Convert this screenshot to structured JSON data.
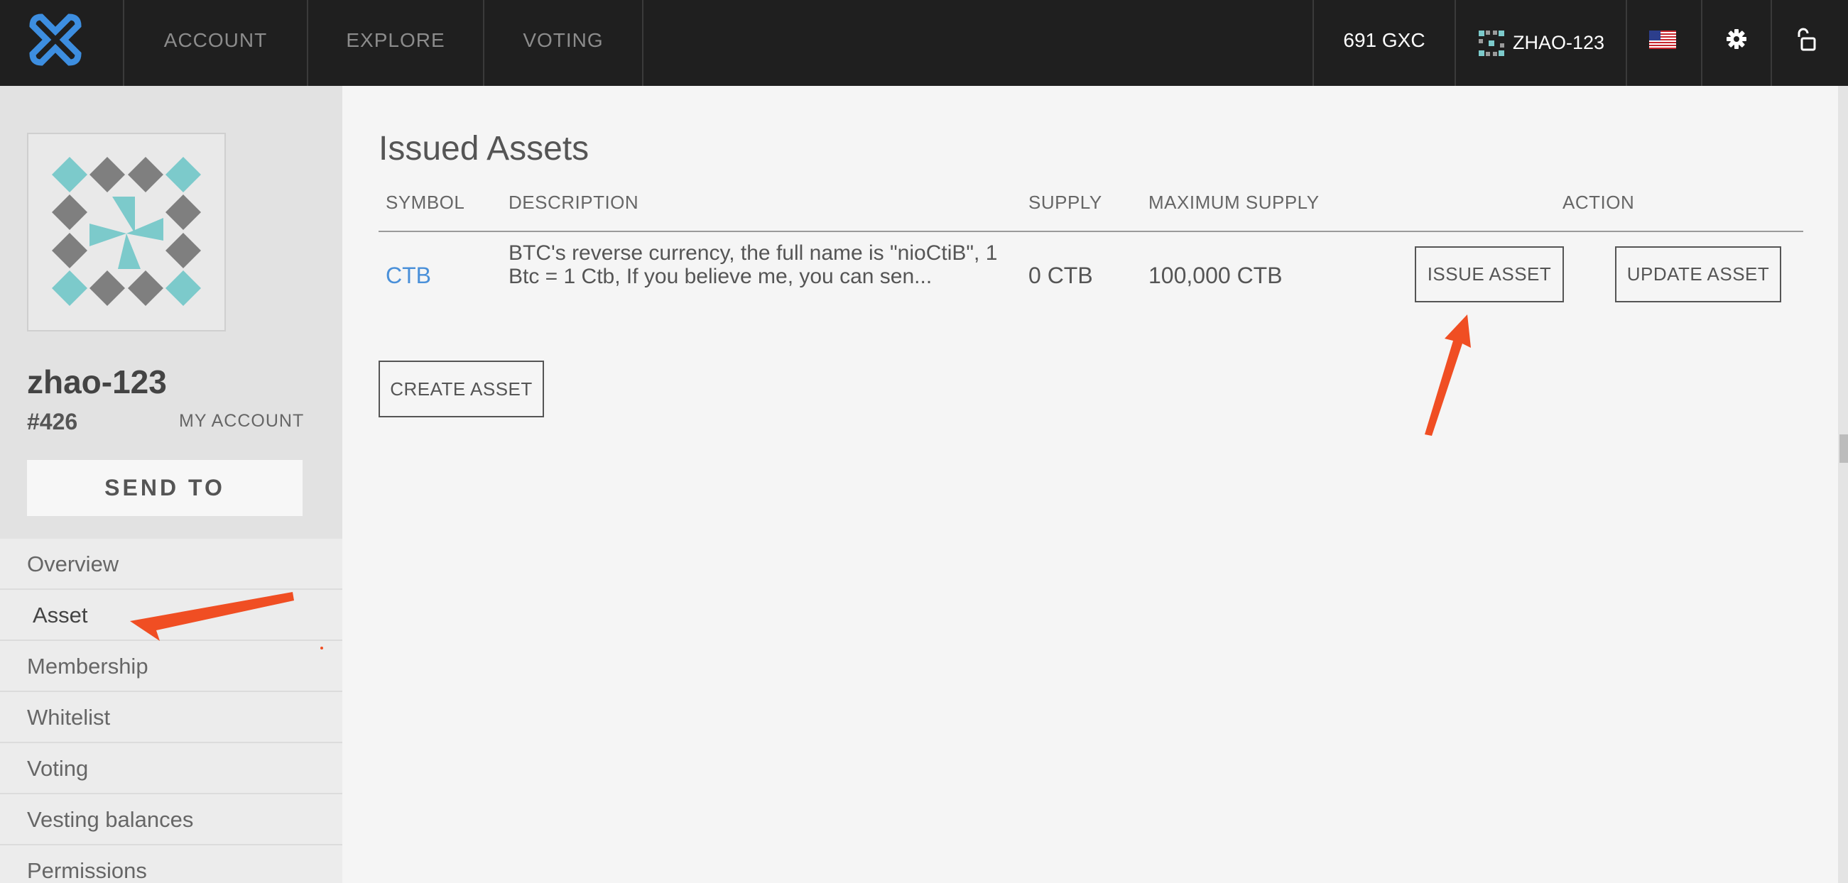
{
  "nav": {
    "items": [
      {
        "label": "ACCOUNT"
      },
      {
        "label": "EXPLORE"
      },
      {
        "label": "VOTING"
      }
    ],
    "balance": "691 GXC",
    "account": "ZHAO-123",
    "icons": [
      "gxc-logo-icon",
      "identicon-icon",
      "us-flag-icon",
      "gear-icon",
      "unlock-icon"
    ]
  },
  "sidebar": {
    "account_name": "zhao-123",
    "account_id": "#426",
    "my_account": "MY ACCOUNT",
    "send_to": "SEND TO",
    "menu": [
      {
        "label": "Overview"
      },
      {
        "label": "Asset"
      },
      {
        "label": "Membership"
      },
      {
        "label": "Whitelist"
      },
      {
        "label": "Voting"
      },
      {
        "label": "Vesting balances"
      },
      {
        "label": "Permissions"
      }
    ]
  },
  "main": {
    "title": "Issued Assets",
    "columns": {
      "symbol": "SYMBOL",
      "description": "DESCRIPTION",
      "supply": "SUPPLY",
      "max_supply": "MAXIMUM SUPPLY",
      "action": "ACTION"
    },
    "rows": [
      {
        "symbol": "CTB",
        "description": "BTC's reverse currency, the full name is \"nioCtiB\", 1 Btc = 1 Ctb, If you believe me, you can sen...",
        "supply": "0 CTB",
        "max_supply": "100,000 CTB",
        "issue_label": "ISSUE ASSET",
        "update_label": "UPDATE ASSET"
      }
    ],
    "create_label": "CREATE ASSET"
  },
  "colors": {
    "topbar": "#1f1f1f",
    "accent": "#4a90d9",
    "logo": "#3d8ee0",
    "annotation_arrow": "#f04e23",
    "identicon_teal": "#7ccacb",
    "identicon_gray": "#7f7f7f"
  }
}
